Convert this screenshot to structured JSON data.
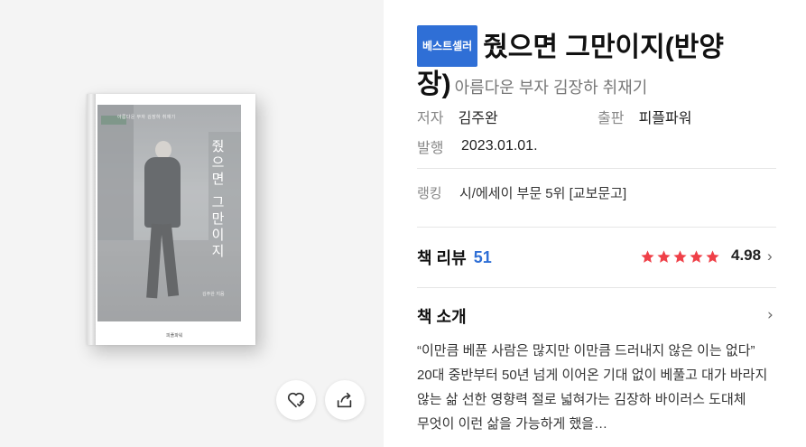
{
  "book": {
    "title": "줬으면 그만이지(반양장)",
    "title_part1": "줬으면 그만이지(반양",
    "title_part2": "장)",
    "subtitle": "아름다운 부자 김장하 취재기",
    "badge": "베스트셀러",
    "cover": {
      "vertical_title": "줬으면 그만이지",
      "subtitle": "아름다운 부자 김장하 취재기",
      "author": "김주완 지음",
      "publisher": "피플파워"
    }
  },
  "meta": {
    "author_label": "저자",
    "author": "김주완",
    "publisher_label": "출판",
    "publisher": "피플파워",
    "date_label": "발행",
    "date": "2023.01.01."
  },
  "ranking": {
    "label": "랭킹",
    "value": "시/에세이 부문 5위 [교보문고]"
  },
  "review": {
    "label": "책 리뷰",
    "count": "51",
    "stars": 5,
    "score": "4.98"
  },
  "intro": {
    "label": "책 소개",
    "text": "“이만큼 베푼 사람은 많지만 이만큼 드러내지 않은 이는 없다” 20대 중반부터 50년 넘게 이어온 기대 없이 베풀고 대가 바라지 않는 삶 선한 영향력 절로 넓혀가는 김장하 바이러스 도대체 무엇이 이런 삶을 가능하게 했을…"
  },
  "actions": {
    "wish_icon": "heart-check-icon",
    "share_icon": "share-icon"
  },
  "colors": {
    "accent": "#2f6fd6",
    "star": "#ef4048"
  }
}
